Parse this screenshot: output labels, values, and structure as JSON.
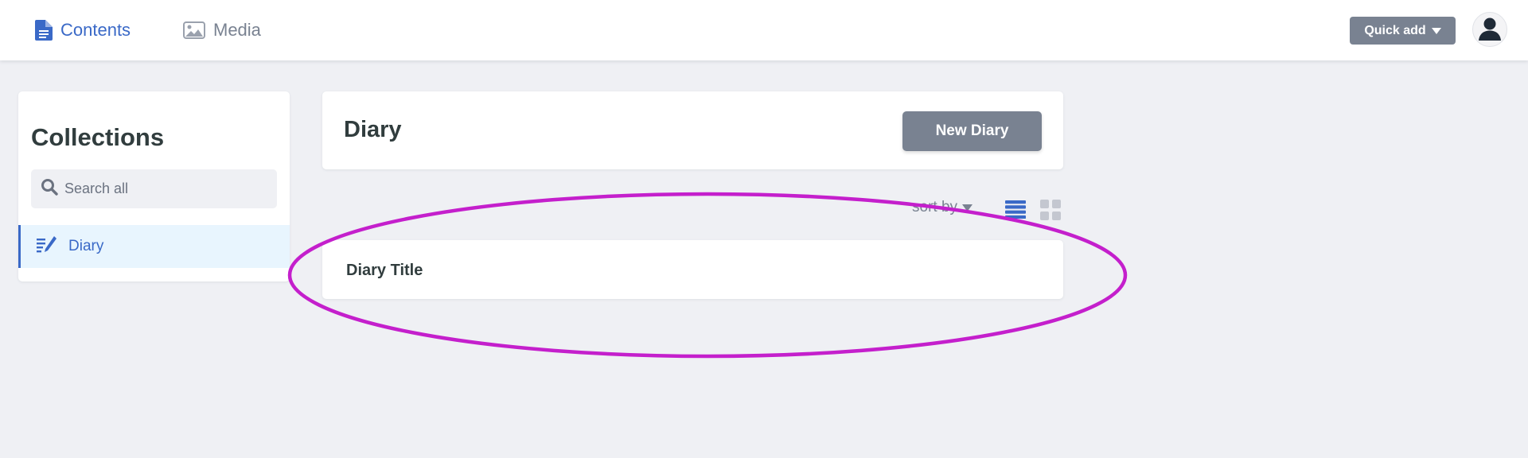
{
  "topbar": {
    "nav": [
      {
        "label": "Contents",
        "icon": "document-icon",
        "active": true
      },
      {
        "label": "Media",
        "icon": "image-icon",
        "active": false
      }
    ],
    "quick_add_label": "Quick add",
    "avatar_icon": "user-icon"
  },
  "sidebar": {
    "title": "Collections",
    "search_placeholder": "Search all",
    "items": [
      {
        "label": "Diary",
        "icon": "diary-icon",
        "active": true
      }
    ]
  },
  "main": {
    "title": "Diary",
    "new_button_label": "New Diary",
    "sort_label": "sort by",
    "view_modes": [
      "list-view-icon",
      "grid-view-icon"
    ],
    "entries": [
      {
        "title": "Diary Title"
      }
    ]
  },
  "colors": {
    "accent": "#3a69c7",
    "button": "#798291",
    "background": "#eff0f4",
    "annotation": "#c41fcc"
  }
}
